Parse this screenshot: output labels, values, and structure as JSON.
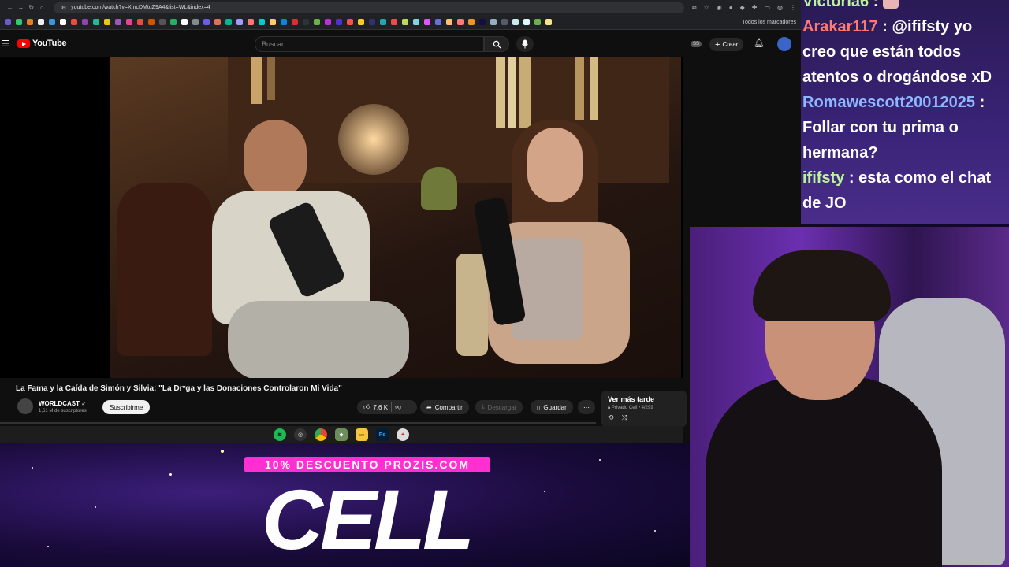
{
  "browser": {
    "url": "youtube.com/watch?v=XmcDMtuZ9A4&list=WL&index=4",
    "bookmarks_label": "Todos los marcadores"
  },
  "youtube": {
    "logo_text": "YouTube",
    "search_placeholder": "Buscar",
    "ss_badge": "SS",
    "create_label": "Crear",
    "video": {
      "title": "La Fama y la Caída de Simón y Silvia: \"La Dr*ga y las Donaciones Controlaron Mi Vida\"",
      "channel": "WORLDCAST",
      "subscribers": "1,61 M de suscriptores",
      "subscribe_label": "Suscribirme",
      "likes": "7,6 K",
      "share_label": "Compartir",
      "download_label": "Descargar",
      "save_label": "Guardar"
    },
    "playlist": {
      "title": "Ver más tarde",
      "meta": "Privado Cell • 4/299"
    }
  },
  "taskbar": {
    "apps": [
      "spotify",
      "obs",
      "chrome",
      "app4",
      "files",
      "Ps",
      "app7"
    ]
  },
  "chat": {
    "messages": [
      {
        "user": "Victoria6",
        "text": ""
      },
      {
        "user": "Arakar117",
        "text": "@ififsty yo creo que están todos atentos o drogándose xD"
      },
      {
        "user": "Romawescott20012025",
        "text": "Follar con tu prima o hermana?"
      },
      {
        "user": "ififsty",
        "text": "esta como el chat de JO"
      }
    ]
  },
  "banner": {
    "promo": "10% DESCUENTO PROZIS.COM",
    "title": "CELL"
  }
}
